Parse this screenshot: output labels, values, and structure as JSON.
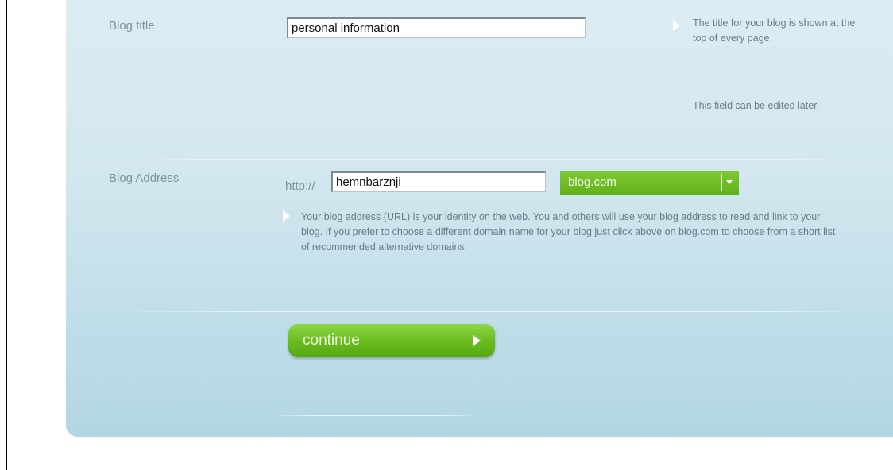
{
  "form": {
    "blog_title": {
      "label": "Blog title",
      "value": "personal information",
      "hint": "The title for your blog is shown at the top of every page.",
      "hint2": "This field can be edited later."
    },
    "blog_address": {
      "label": "Blog Address",
      "prefix": "http://",
      "value": "hemnbarznji",
      "domain": "blog.com",
      "hint": "Your blog address (URL) is your identity on the web. You and others will use your blog address to read and link to your blog. If you prefer to choose a different domain name for your blog just click above on blog.com to choose from a short list of recommended alternative domains."
    },
    "continue_label": "continue"
  },
  "colors": {
    "accent_green": "#6bbd22",
    "panel_blue": "#cfe6ee"
  }
}
